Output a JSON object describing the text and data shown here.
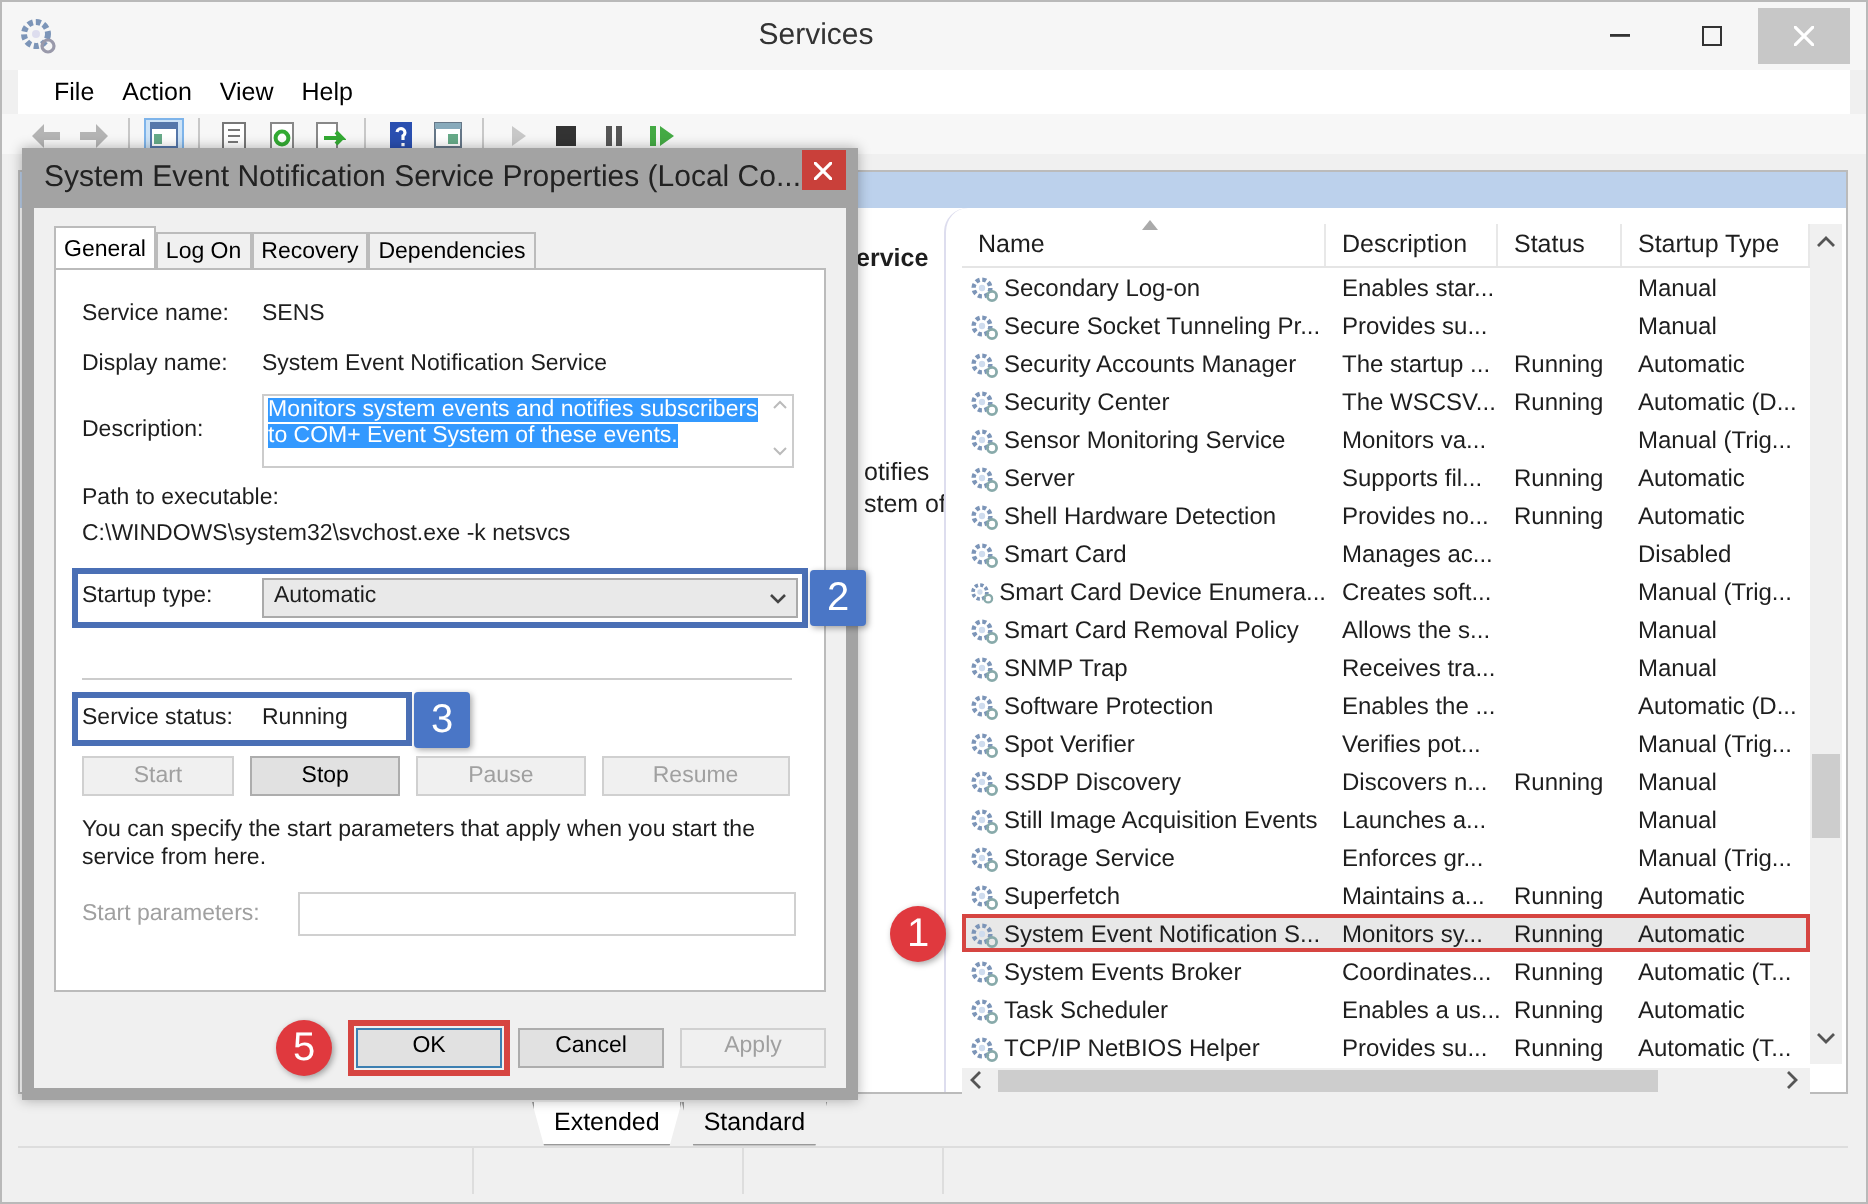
{
  "window": {
    "title": "Services"
  },
  "menu": [
    "File",
    "Action",
    "View",
    "Help"
  ],
  "toolbar": [
    {
      "kind": "back",
      "disabled": true,
      "selected": false
    },
    {
      "kind": "forward",
      "disabled": true,
      "selected": false
    },
    {
      "kind": "sep"
    },
    {
      "kind": "tree",
      "disabled": false,
      "selected": true
    },
    {
      "kind": "sep"
    },
    {
      "kind": "props",
      "disabled": false,
      "selected": false
    },
    {
      "kind": "refresh",
      "disabled": false,
      "selected": false
    },
    {
      "kind": "export",
      "disabled": false,
      "selected": false
    },
    {
      "kind": "sep"
    },
    {
      "kind": "help",
      "disabled": false,
      "selected": false
    },
    {
      "kind": "view",
      "disabled": false,
      "selected": false
    },
    {
      "kind": "sep"
    },
    {
      "kind": "play",
      "disabled": true,
      "selected": false
    },
    {
      "kind": "stop",
      "disabled": false,
      "selected": false
    },
    {
      "kind": "pause",
      "disabled": false,
      "selected": false
    },
    {
      "kind": "resume",
      "disabled": false,
      "selected": false
    }
  ],
  "left_pane": {
    "heading": "ervice",
    "description": [
      "otifies",
      "stem of"
    ]
  },
  "table": {
    "columns": [
      "Name",
      "Description",
      "Status",
      "Startup Type"
    ],
    "rows": [
      {
        "name": "Secondary Log-on",
        "description": "Enables star...",
        "status": "",
        "startup": "Manual",
        "selected": false
      },
      {
        "name": "Secure Socket Tunneling Pr...",
        "description": "Provides su...",
        "status": "",
        "startup": "Manual",
        "selected": false
      },
      {
        "name": "Security Accounts Manager",
        "description": "The startup ...",
        "status": "Running",
        "startup": "Automatic",
        "selected": false
      },
      {
        "name": "Security Center",
        "description": "The WSCSV...",
        "status": "Running",
        "startup": "Automatic (D...",
        "selected": false
      },
      {
        "name": "Sensor Monitoring Service",
        "description": "Monitors va...",
        "status": "",
        "startup": "Manual (Trig...",
        "selected": false
      },
      {
        "name": "Server",
        "description": "Supports fil...",
        "status": "Running",
        "startup": "Automatic",
        "selected": false
      },
      {
        "name": "Shell Hardware Detection",
        "description": "Provides no...",
        "status": "Running",
        "startup": "Automatic",
        "selected": false
      },
      {
        "name": "Smart Card",
        "description": "Manages ac...",
        "status": "",
        "startup": "Disabled",
        "selected": false
      },
      {
        "name": "Smart Card Device Enumera...",
        "description": "Creates soft...",
        "status": "",
        "startup": "Manual (Trig...",
        "selected": false
      },
      {
        "name": "Smart Card Removal Policy",
        "description": "Allows the s...",
        "status": "",
        "startup": "Manual",
        "selected": false
      },
      {
        "name": "SNMP Trap",
        "description": "Receives tra...",
        "status": "",
        "startup": "Manual",
        "selected": false
      },
      {
        "name": "Software Protection",
        "description": "Enables the ...",
        "status": "",
        "startup": "Automatic (D...",
        "selected": false
      },
      {
        "name": "Spot Verifier",
        "description": "Verifies pot...",
        "status": "",
        "startup": "Manual (Trig...",
        "selected": false
      },
      {
        "name": "SSDP Discovery",
        "description": "Discovers n...",
        "status": "Running",
        "startup": "Manual",
        "selected": false
      },
      {
        "name": "Still Image Acquisition Events",
        "description": "Launches a...",
        "status": "",
        "startup": "Manual",
        "selected": false
      },
      {
        "name": "Storage Service",
        "description": "Enforces gr...",
        "status": "",
        "startup": "Manual (Trig...",
        "selected": false
      },
      {
        "name": "Superfetch",
        "description": "Maintains a...",
        "status": "Running",
        "startup": "Automatic",
        "selected": false
      },
      {
        "name": "System Event Notification S...",
        "description": "Monitors sy...",
        "status": "Running",
        "startup": "Automatic",
        "selected": true
      },
      {
        "name": "System Events Broker",
        "description": "Coordinates...",
        "status": "Running",
        "startup": "Automatic (T...",
        "selected": false
      },
      {
        "name": "Task Scheduler",
        "description": "Enables a us...",
        "status": "Running",
        "startup": "Automatic",
        "selected": false
      },
      {
        "name": "TCP/IP NetBIOS Helper",
        "description": "Provides su...",
        "status": "Running",
        "startup": "Automatic (T...",
        "selected": false
      }
    ]
  },
  "view_tabs": [
    {
      "label": "Extended",
      "selected": true
    },
    {
      "label": "Standard",
      "selected": false
    }
  ],
  "dialog": {
    "title": "System Event Notification Service Properties (Local Co...",
    "tabs": [
      {
        "label": "General",
        "selected": true
      },
      {
        "label": "Log On",
        "selected": false
      },
      {
        "label": "Recovery",
        "selected": false
      },
      {
        "label": "Dependencies",
        "selected": false
      }
    ],
    "service_name": {
      "label": "Service name:",
      "value": "SENS"
    },
    "display_name": {
      "label": "Display name:",
      "value": "System Event Notification Service"
    },
    "description": {
      "label": "Description:",
      "value": "Monitors system events and notifies subscribers to COM+ Event System of these events.",
      "text_selected": true
    },
    "path": {
      "label": "Path to executable:",
      "value": "C:\\WINDOWS\\system32\\svchost.exe -k netsvcs"
    },
    "startup_type": {
      "label": "Startup type:",
      "value": "Automatic"
    },
    "service_status": {
      "label": "Service status:",
      "value": "Running"
    },
    "service_buttons": [
      {
        "label": "Start",
        "disabled": true
      },
      {
        "label": "Stop",
        "disabled": false
      },
      {
        "label": "Pause",
        "disabled": true
      },
      {
        "label": "Resume",
        "disabled": true
      }
    ],
    "hint": "You can specify the start parameters that apply when you start the service from here.",
    "start_parameters": {
      "label": "Start parameters:",
      "disabled": true
    },
    "buttons": [
      {
        "label": "OK",
        "default": true,
        "disabled": false
      },
      {
        "label": "Cancel",
        "default": false,
        "disabled": false
      },
      {
        "label": "Apply",
        "default": false,
        "disabled": true
      }
    ]
  },
  "annotations": [
    {
      "number": "1",
      "kind": "circle",
      "color": "#e0393e"
    },
    {
      "number": "2",
      "kind": "square",
      "color": "#4a76c6"
    },
    {
      "number": "3",
      "kind": "square",
      "color": "#4a76c6"
    },
    {
      "number": "5",
      "kind": "circle",
      "color": "#e0393e"
    }
  ]
}
